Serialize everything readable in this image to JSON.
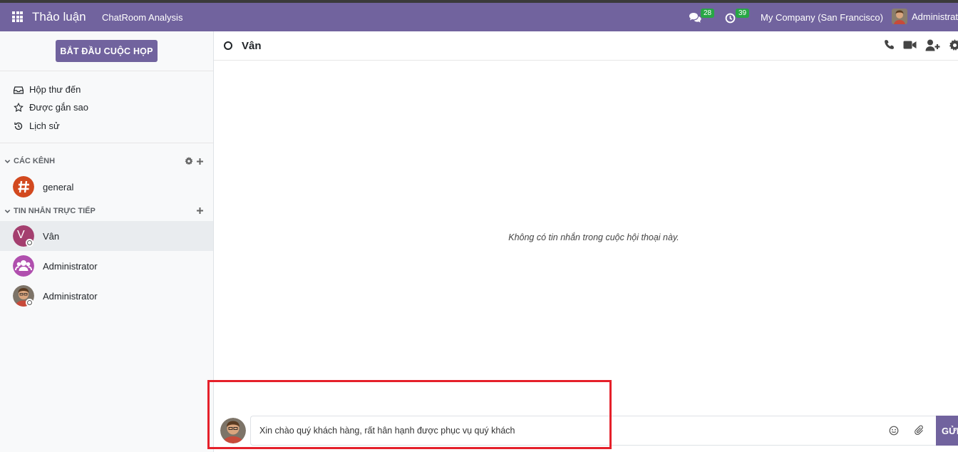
{
  "navbar": {
    "brand": "Thảo luận",
    "menu_item": "ChatRoom Analysis",
    "messages_count": "28",
    "activities_count": "39",
    "company": "My Company (San Francisco)",
    "user_name": "Administrator"
  },
  "sidebar": {
    "start_meeting_label": "BẮT ĐẦU CUỘC HỌP",
    "mailboxes": [
      {
        "label": "Hộp thư đến",
        "icon": "inbox-icon"
      },
      {
        "label": "Được gắn sao",
        "icon": "star-icon"
      },
      {
        "label": "Lịch sử",
        "icon": "history-icon"
      }
    ],
    "channels_header": "CÁC KÊNH",
    "channels": [
      {
        "name": "general"
      }
    ],
    "dm_header": "TIN NHẮN TRỰC TIẾP",
    "direct_messages": [
      {
        "name": "Vân",
        "initial": "V",
        "active": true
      },
      {
        "name": "Administrator"
      },
      {
        "name": "Administrator"
      }
    ]
  },
  "thread": {
    "name": "Vân",
    "empty_message": "Không có tin nhắn trong cuộc hội thoại này."
  },
  "composer": {
    "value": "Xin chào quý khách hàng, rất hân hạnh được phục vụ quý khách",
    "send_label": "GỬI"
  },
  "colors": {
    "primary": "#71639e",
    "badge": "#28a745",
    "general_channel": "#d2491f",
    "van_avatar": "#a43f6f",
    "group_avatar": "#b04fae",
    "highlight": "#e5202a"
  }
}
